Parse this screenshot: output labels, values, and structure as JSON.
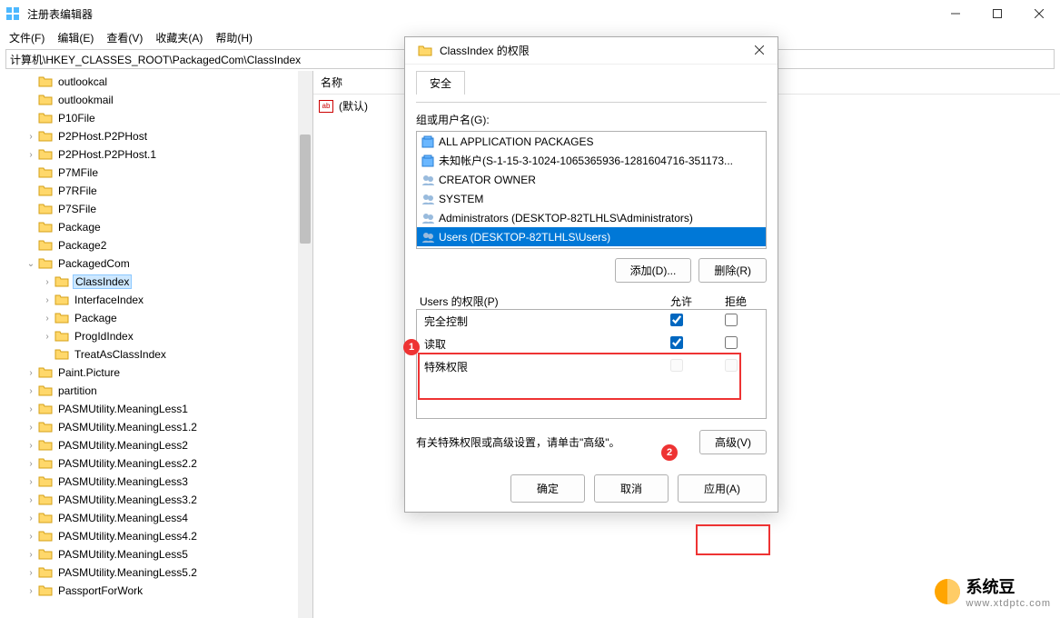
{
  "window": {
    "title": "注册表编辑器"
  },
  "menu": {
    "file": "文件(F)",
    "edit": "编辑(E)",
    "view": "查看(V)",
    "fav": "收藏夹(A)",
    "help": "帮助(H)"
  },
  "address": "计算机\\HKEY_CLASSES_ROOT\\PackagedCom\\ClassIndex",
  "list": {
    "header_name": "名称",
    "default_row": "(默认)"
  },
  "tree": [
    {
      "l": 2,
      "n": "outlookcal",
      "e": ""
    },
    {
      "l": 2,
      "n": "outlookmail",
      "e": ""
    },
    {
      "l": 2,
      "n": "P10File",
      "e": ""
    },
    {
      "l": 2,
      "n": "P2PHost.P2PHost",
      "e": ">"
    },
    {
      "l": 2,
      "n": "P2PHost.P2PHost.1",
      "e": ">"
    },
    {
      "l": 2,
      "n": "P7MFile",
      "e": ""
    },
    {
      "l": 2,
      "n": "P7RFile",
      "e": ""
    },
    {
      "l": 2,
      "n": "P7SFile",
      "e": ""
    },
    {
      "l": 2,
      "n": "Package",
      "e": ""
    },
    {
      "l": 2,
      "n": "Package2",
      "e": ""
    },
    {
      "l": 2,
      "n": "PackagedCom",
      "e": "v"
    },
    {
      "l": 3,
      "n": "ClassIndex",
      "e": ">",
      "sel": true
    },
    {
      "l": 3,
      "n": "InterfaceIndex",
      "e": ">"
    },
    {
      "l": 3,
      "n": "Package",
      "e": ">"
    },
    {
      "l": 3,
      "n": "ProgIdIndex",
      "e": ">"
    },
    {
      "l": 3,
      "n": "TreatAsClassIndex",
      "e": ""
    },
    {
      "l": 2,
      "n": "Paint.Picture",
      "e": ">"
    },
    {
      "l": 2,
      "n": "partition",
      "e": ">"
    },
    {
      "l": 2,
      "n": "PASMUtility.MeaningLess1",
      "e": ">"
    },
    {
      "l": 2,
      "n": "PASMUtility.MeaningLess1.2",
      "e": ">"
    },
    {
      "l": 2,
      "n": "PASMUtility.MeaningLess2",
      "e": ">"
    },
    {
      "l": 2,
      "n": "PASMUtility.MeaningLess2.2",
      "e": ">"
    },
    {
      "l": 2,
      "n": "PASMUtility.MeaningLess3",
      "e": ">"
    },
    {
      "l": 2,
      "n": "PASMUtility.MeaningLess3.2",
      "e": ">"
    },
    {
      "l": 2,
      "n": "PASMUtility.MeaningLess4",
      "e": ">"
    },
    {
      "l": 2,
      "n": "PASMUtility.MeaningLess4.2",
      "e": ">"
    },
    {
      "l": 2,
      "n": "PASMUtility.MeaningLess5",
      "e": ">"
    },
    {
      "l": 2,
      "n": "PASMUtility.MeaningLess5.2",
      "e": ">"
    },
    {
      "l": 2,
      "n": "PassportForWork",
      "e": ">"
    }
  ],
  "dialog": {
    "title": "ClassIndex 的权限",
    "tab": "安全",
    "group_label": "组或用户名(G):",
    "groups": [
      {
        "icon": "pkg",
        "n": "ALL APPLICATION PACKAGES"
      },
      {
        "icon": "pkg",
        "n": "未知帐户(S-1-15-3-1024-1065365936-1281604716-351173..."
      },
      {
        "icon": "grp",
        "n": "CREATOR OWNER"
      },
      {
        "icon": "grp",
        "n": "SYSTEM"
      },
      {
        "icon": "grp",
        "n": "Administrators (DESKTOP-82TLHLS\\Administrators)"
      },
      {
        "icon": "grp",
        "n": "Users (DESKTOP-82TLHLS\\Users)",
        "sel": true
      }
    ],
    "add_btn": "添加(D)...",
    "remove_btn": "删除(R)",
    "perm_label": "Users 的权限(P)",
    "col_allow": "允许",
    "col_deny": "拒绝",
    "perms": [
      {
        "n": "完全控制",
        "allow": true,
        "deny": false
      },
      {
        "n": "读取",
        "allow": true,
        "deny": false
      },
      {
        "n": "特殊权限",
        "allow": false,
        "deny": false,
        "dis": true
      }
    ],
    "adv_text": "有关特殊权限或高级设置，请单击\"高级\"。",
    "adv_btn": "高级(V)",
    "ok": "确定",
    "cancel": "取消",
    "apply": "应用(A)",
    "badge1": "1",
    "badge2": "2"
  },
  "watermark": {
    "name": "系统豆",
    "url": "www.xtdptc.com"
  }
}
